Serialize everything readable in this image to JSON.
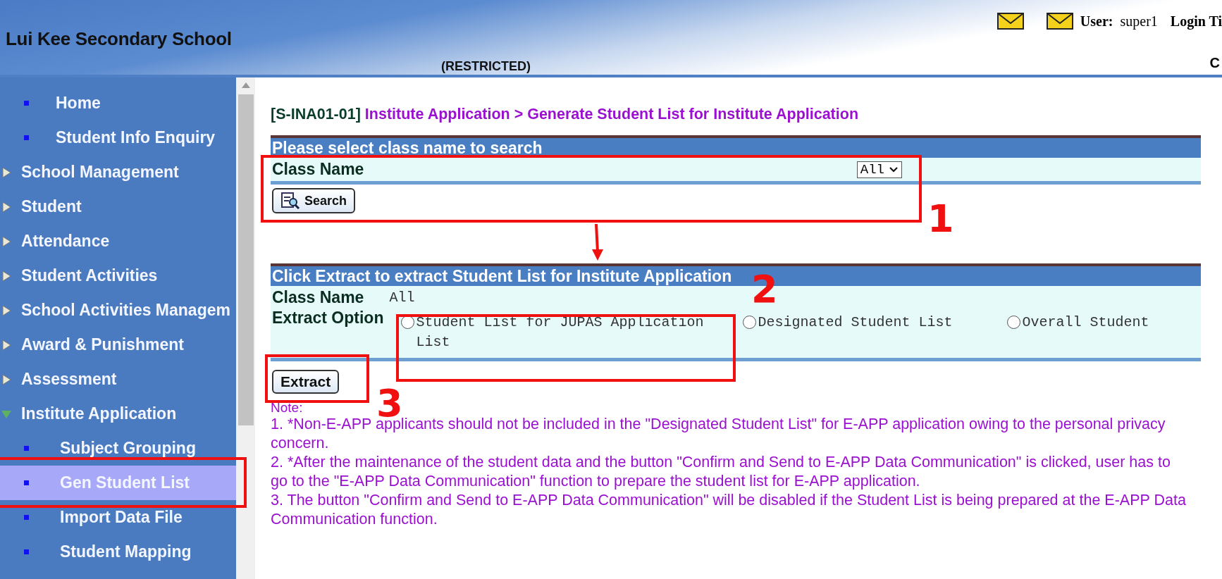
{
  "header": {
    "school_name": "Lui Kee Secondary School",
    "restricted_label": "(RESTRICTED)",
    "user_label": "User:",
    "user_name": "super1",
    "login_label": "Login Ti",
    "cut_text": "C"
  },
  "sidebar": {
    "items": [
      {
        "kind": "leaf",
        "label": "Home",
        "selected": false
      },
      {
        "kind": "leaf",
        "label": "Student Info Enquiry",
        "selected": false
      },
      {
        "kind": "group",
        "label": "School Management",
        "expanded": false
      },
      {
        "kind": "group",
        "label": "Student",
        "expanded": false
      },
      {
        "kind": "group",
        "label": "Attendance",
        "expanded": false
      },
      {
        "kind": "group",
        "label": "Student Activities",
        "expanded": false
      },
      {
        "kind": "group",
        "label": "School Activities Managem",
        "expanded": false
      },
      {
        "kind": "group",
        "label": "Award & Punishment",
        "expanded": false
      },
      {
        "kind": "group",
        "label": "Assessment",
        "expanded": false
      },
      {
        "kind": "group",
        "label": "Institute Application",
        "expanded": true,
        "children": [
          {
            "kind": "leaf",
            "label": "Subject Grouping",
            "selected": false
          },
          {
            "kind": "leaf",
            "label": "Gen Student List",
            "selected": true
          },
          {
            "kind": "leaf",
            "label": "Import Data File",
            "selected": false
          },
          {
            "kind": "leaf",
            "label": "Student Mapping",
            "selected": false
          }
        ]
      }
    ]
  },
  "breadcrumb": {
    "code": "[S-INA01-01]",
    "path": "Institute Application > Generate Student List for Institute Application"
  },
  "search_panel": {
    "title": "Please select class name to search",
    "class_label": "Class Name",
    "class_value": "All",
    "search_button": "Search"
  },
  "extract_panel": {
    "title": "Click Extract to extract Student List for Institute Application",
    "class_label": "Class Name",
    "class_value": "All",
    "option_label": "Extract Option",
    "options": [
      {
        "label": "Student List for JUPAS Application List",
        "selected": false
      },
      {
        "label": "Designated Student List",
        "selected": false
      },
      {
        "label": "Overall Student",
        "selected": false
      }
    ],
    "extract_button": "Extract"
  },
  "notes": {
    "title": "Note:",
    "items": [
      "1. *Non-E-APP applicants should not be included in the \"Designated Student List\" for E-APP application owing to the personal privacy concern.",
      "2. *After the maintenance of the student data and the button \"Confirm and Send to E-APP Data Communication\" is clicked, user has to go to the \"E-APP Data Communication\" function to prepare the student list for E-APP application.",
      "3. The button \"Confirm and Send to E-APP Data Communication\" will be disabled if the Student List is being prepared at the E-APP Data Communication function."
    ]
  },
  "annotations": [
    "1",
    "2",
    "3"
  ]
}
